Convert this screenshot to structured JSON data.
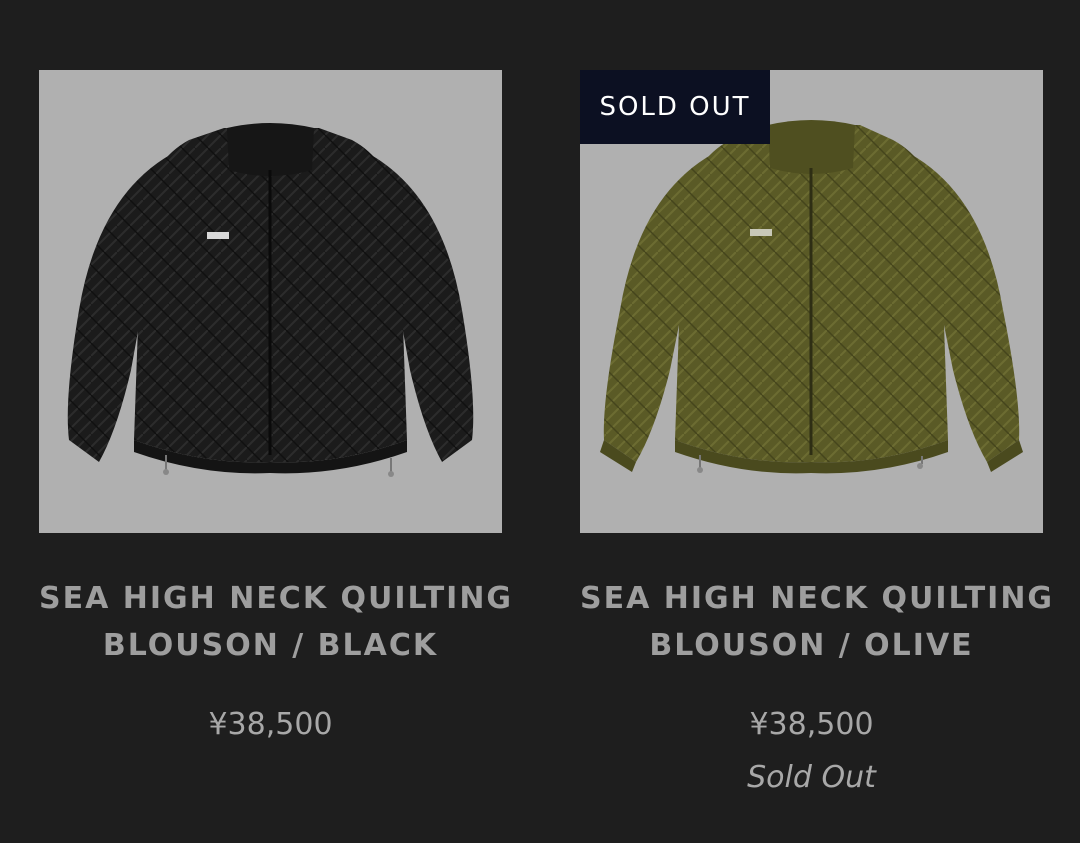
{
  "products": [
    {
      "title_line1": "SEA HIGH NECK QUILTING",
      "title_line2": "BLOUSON / BLACK",
      "price": "¥38,500",
      "image_icon": "jacket-black-image",
      "jacket_color": "#1b1b1b"
    },
    {
      "badge": "SOLD OUT",
      "title_line1": "SEA HIGH NECK QUILTING",
      "title_line2": "BLOUSON / OLIVE",
      "price": "¥38,500",
      "status": "Sold Out",
      "image_icon": "jacket-olive-image",
      "jacket_color": "#5a5a26"
    }
  ],
  "colors": {
    "background": "#1e1e1e",
    "image_bg": "#b0b0b0",
    "badge_bg": "#0c1022",
    "text": "#a8a8a8"
  }
}
